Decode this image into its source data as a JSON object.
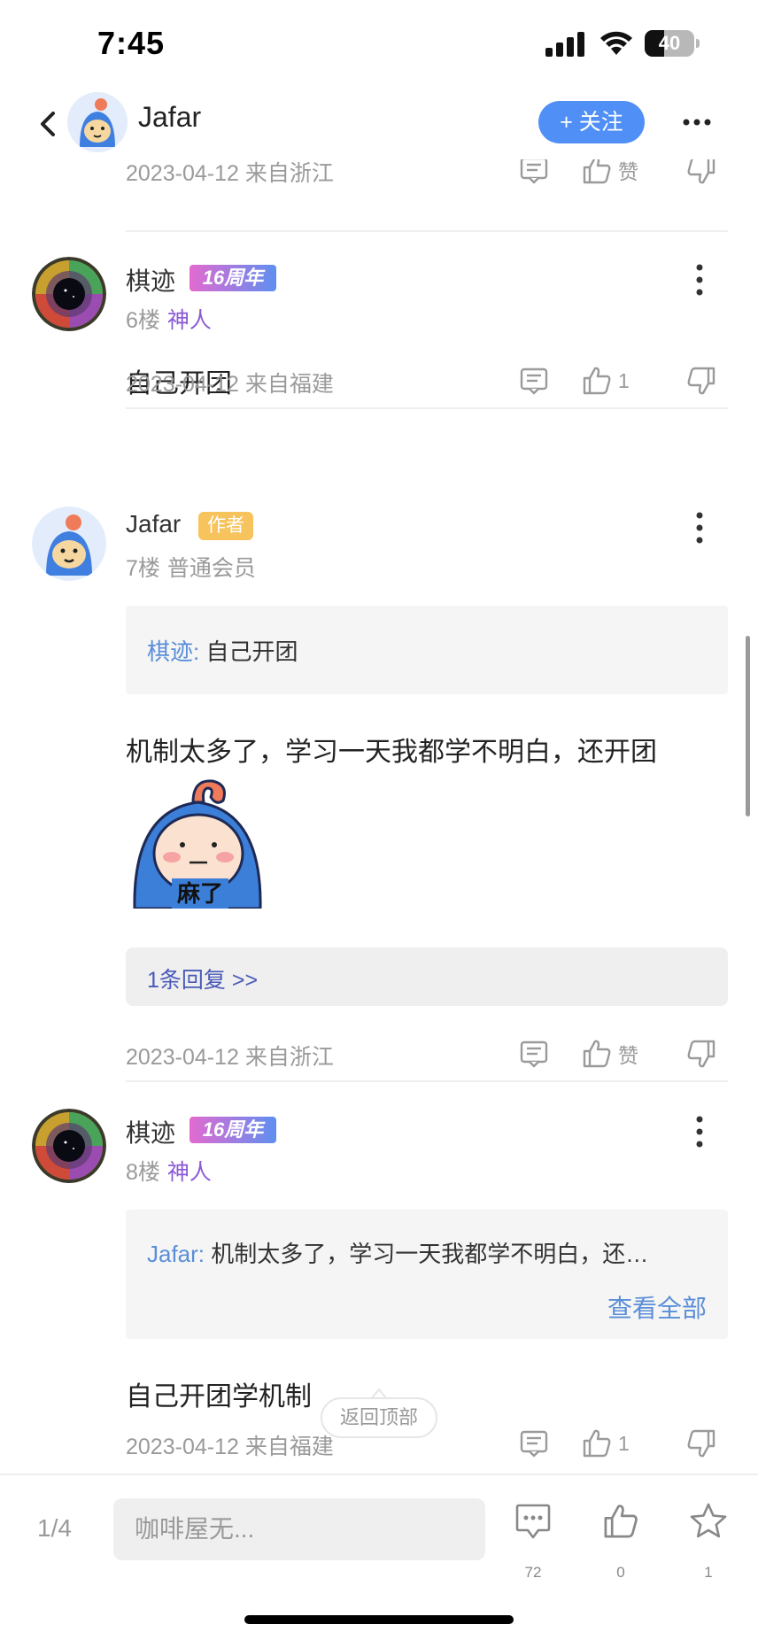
{
  "status_bar": {
    "time": "7:45",
    "battery": "40",
    "battery_level_percent": 40
  },
  "nav": {
    "user_name": "Jafar",
    "follow_label": "+ 关注"
  },
  "first_meta": {
    "date_location": "2023-04-12 来自浙江",
    "like_label": "赞"
  },
  "posts": [
    {
      "user": "棋迹",
      "badge": "16周年",
      "floor": "6楼",
      "role": "神人",
      "body": "自己开团",
      "date_location": "2023-04-12 来自福建",
      "like_label": "1"
    },
    {
      "user": "Jafar",
      "badge": "作者",
      "floor": "7楼",
      "role": "普通会员",
      "quote_who": "棋迹:",
      "quote_text": "自己开团",
      "body": "机制太多了，学习一天我都学不明白，还开团",
      "sticker_text": "麻了",
      "replies_label": "1条回复 >>",
      "date_location": "2023-04-12 来自浙江",
      "like_label": "赞"
    },
    {
      "user": "棋迹",
      "badge": "16周年",
      "floor": "8楼",
      "role": "神人",
      "quote_who": "Jafar:",
      "quote_text": "机制太多了，学习一天我都学不明白，还…",
      "view_all": "查看全部",
      "body": "自己开团学机制",
      "date_location": "2023-04-12 来自福建",
      "like_label": "1"
    }
  ],
  "back_to_top": "返回顶部",
  "bottom_bar": {
    "page_indicator": "1/4",
    "input_placeholder": "咖啡屋无...",
    "comment_count": "72",
    "like_count": "0",
    "favorite_count": "1"
  },
  "colors": {
    "accent_blue": "#4f8ff6",
    "link_blue": "#5a8ed8",
    "role_purple": "#8a5ad6",
    "author_badge": "#f6c35c"
  },
  "icons": [
    "back-icon",
    "more-horizontal-icon",
    "more-vertical-icon",
    "reply-icon",
    "thumbs-up-icon",
    "thumbs-down-icon",
    "comment-icon",
    "star-icon",
    "signal-icon",
    "wifi-icon",
    "battery-icon"
  ]
}
